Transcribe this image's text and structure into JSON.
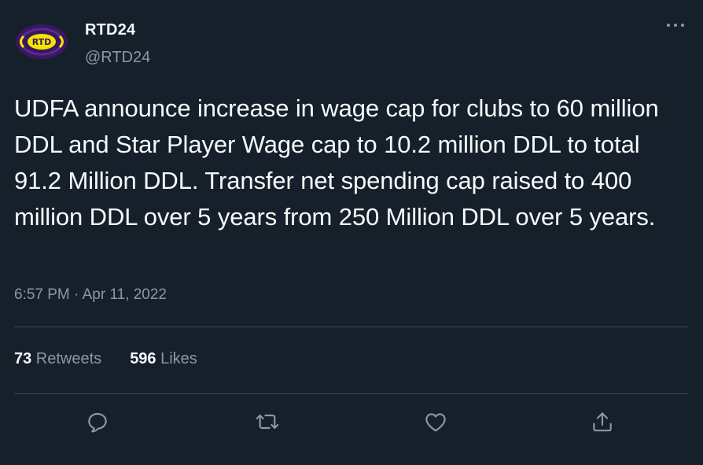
{
  "author": {
    "display_name": "RTD24",
    "handle": "@RTD24",
    "avatar_text": "RTD"
  },
  "more_icon": "more-dots-icon",
  "tweet": {
    "text": "UDFA announce increase in wage cap for clubs to 60 million DDL and Star Player Wage cap to 10.2 million DDL to total 91.2 Million DDL. Transfer net spending cap raised to 400 million DDL over 5 years from 250 Million DDL over 5 years.",
    "timestamp": "6:57 PM · Apr 11, 2022"
  },
  "stats": {
    "retweets_count": "73",
    "retweets_label": " Retweets",
    "likes_count": "596",
    "likes_label": " Likes"
  },
  "actions": {
    "reply_icon": "reply-icon",
    "retweet_icon": "retweet-icon",
    "like_icon": "heart-icon",
    "share_icon": "share-icon"
  },
  "colors": {
    "background": "#15202b",
    "text_primary": "#f7f9f9",
    "text_secondary": "#8b98a5",
    "divider": "#38444d",
    "avatar_ring": "#4b1f7a",
    "avatar_accent": "#f2e600"
  }
}
